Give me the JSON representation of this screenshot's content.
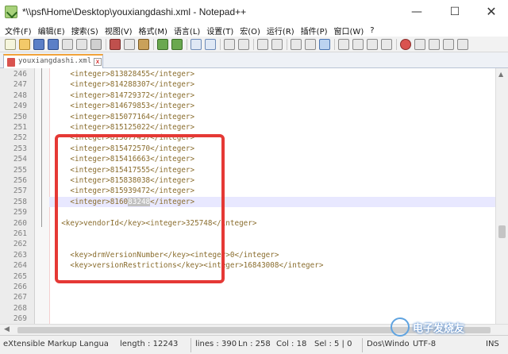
{
  "window": {
    "title": "*\\\\psf\\Home\\Desktop\\youxiangdashi.xml - Notepad++",
    "minimize": "—",
    "maximize": "☐",
    "close": "✕"
  },
  "menu": [
    "文件(F)",
    "编辑(E)",
    "搜索(S)",
    "视图(V)",
    "格式(M)",
    "语言(L)",
    "设置(T)",
    "宏(O)",
    "运行(R)",
    "插件(P)",
    "窗口(W)",
    "?"
  ],
  "tab": {
    "label": "youxiangdashi.xml",
    "close": "x"
  },
  "editor": {
    "lines": [
      {
        "num": "246",
        "text": "    <integer>813828455</integer>"
      },
      {
        "num": "247",
        "text": "    <integer>814288307</integer>"
      },
      {
        "num": "248",
        "text": "    <integer>814729372</integer>"
      },
      {
        "num": "249",
        "text": "    <integer>814679853</integer>"
      },
      {
        "num": "250",
        "text": "    <integer>815077164</integer>"
      },
      {
        "num": "251",
        "text": "    <integer>815125022</integer>"
      },
      {
        "num": "252",
        "text": "    <integer>815077437</integer>"
      },
      {
        "num": "253",
        "text": "    <integer>815472570</integer>"
      },
      {
        "num": "254",
        "text": "    <integer>815416663</integer>"
      },
      {
        "num": "255",
        "text": "    <integer>815417555</integer>"
      },
      {
        "num": "256",
        "text": "    <integer>815838038</integer>"
      },
      {
        "num": "257",
        "text": "    <integer>815939472</integer>"
      },
      {
        "num": "258",
        "text": "    <integer>816083248</integer>"
      },
      {
        "num": "259",
        "text": ""
      },
      {
        "num": "260",
        "text": "  <key>vendorId</key><integer>325748</integer>"
      },
      {
        "num": "261",
        "text": ""
      },
      {
        "num": "262",
        "text": ""
      },
      {
        "num": "263",
        "text": "    <key>drmVersionNumber</key><integer>0</integer>"
      },
      {
        "num": "264",
        "text": "    <key>versionRestrictions</key><integer>16843008</integer>"
      },
      {
        "num": "265",
        "text": ""
      },
      {
        "num": "266",
        "text": ""
      },
      {
        "num": "267",
        "text": ""
      },
      {
        "num": "268",
        "text": ""
      },
      {
        "num": "269",
        "text": ""
      }
    ],
    "current_line": "258",
    "line258": {
      "before": "    <integer>8160",
      "selected": "83248",
      "after": "</integer>"
    }
  },
  "status": {
    "language": "eXtensible Markup Langua",
    "length": "length : 12243",
    "lines": "lines : 390",
    "ln": "Ln : 258",
    "col": "Col : 18",
    "sel": "Sel : 5 | 0",
    "eol": "Dos\\Windo",
    "encoding": "UTF-8",
    "mode": "INS"
  },
  "watermark": {
    "text": "电子发烧友"
  },
  "colors": {
    "highlight_box": "#e53935",
    "xml_text": "#8a6d2e",
    "current_line_bg": "#e8e8ff"
  }
}
